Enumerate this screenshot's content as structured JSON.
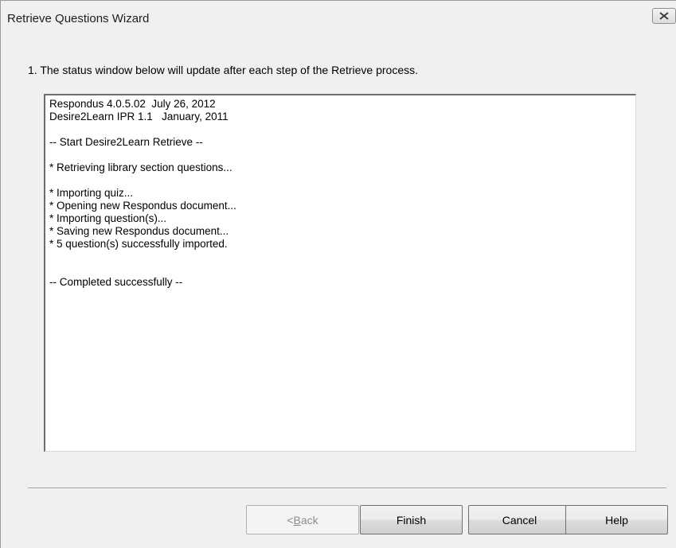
{
  "window": {
    "title": "Retrieve Questions Wizard"
  },
  "icons": {
    "close": "close-x-icon"
  },
  "instruction": "1.  The status window below will update after each step of the Retrieve process.",
  "status_log": [
    "Respondus 4.0.5.02  July 26, 2012",
    "Desire2Learn IPR 1.1   January, 2011",
    "",
    "-- Start Desire2Learn Retrieve --",
    "",
    "* Retrieving library section questions...",
    "",
    "* Importing quiz...",
    "* Opening new Respondus document...",
    "* Importing question(s)...",
    "* Saving new Respondus document...",
    "* 5 question(s) successfully imported.",
    "",
    "",
    "-- Completed successfully --"
  ],
  "buttons": {
    "back_prefix": "< ",
    "back_mnemonic": "B",
    "back_rest": "ack",
    "finish": "Finish",
    "cancel": "Cancel",
    "help": "Help"
  },
  "colors": {
    "dialog_bg": "#f0f0f0",
    "text_box_bg": "#ffffff",
    "disabled_text": "#8d8d8d"
  }
}
